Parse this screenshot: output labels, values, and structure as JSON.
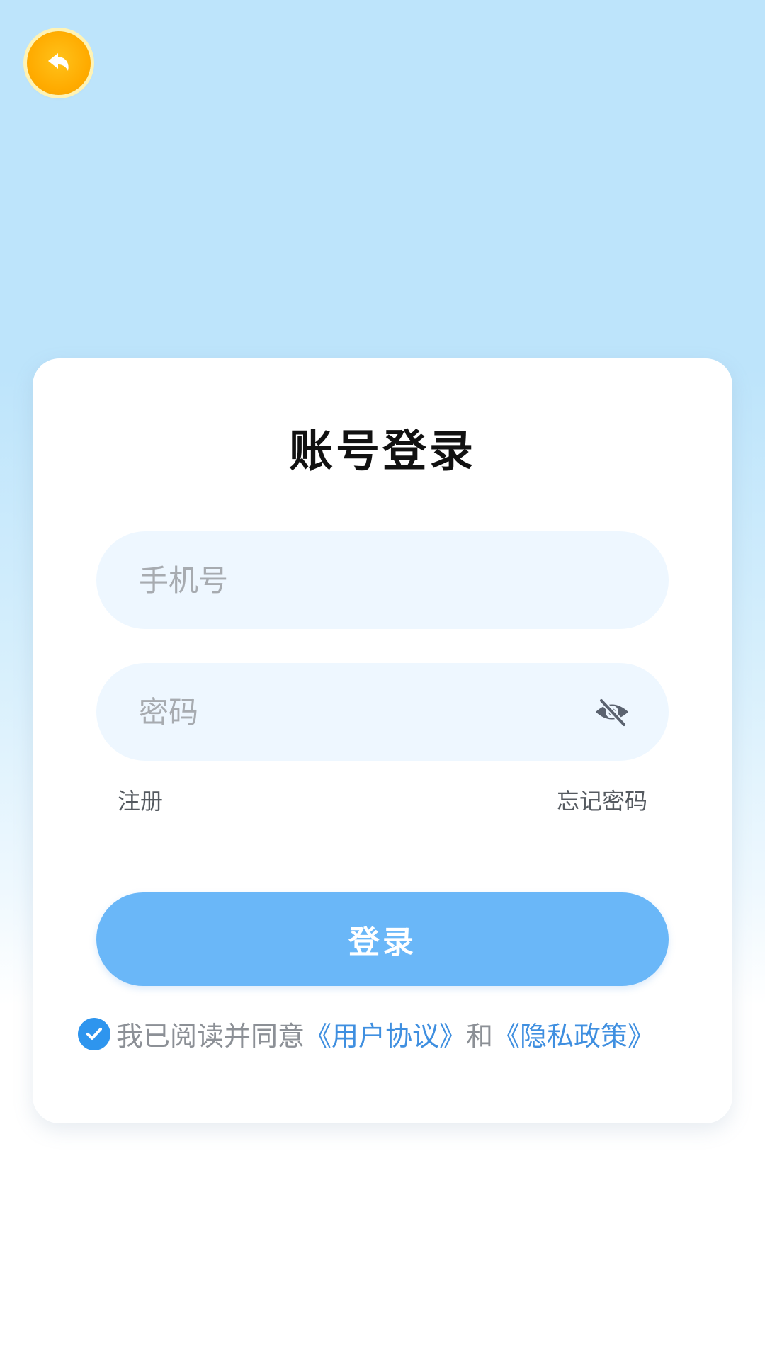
{
  "header": {
    "back_icon": "undo-arrow-icon",
    "back_color": "#ffab00"
  },
  "login_card": {
    "title": "账号登录",
    "phone": {
      "value": "",
      "placeholder": "手机号"
    },
    "password": {
      "value": "",
      "placeholder": "密码",
      "visibility_icon": "eye-off-icon"
    },
    "register_label": "注册",
    "forgot_password_label": "忘记密码",
    "login_button_label": "登录",
    "agreement": {
      "checked": true,
      "prefix": "我已阅读并同意",
      "user_agreement": "《用户协议》",
      "conjunction": "和",
      "privacy_policy": "《隐私政策》"
    }
  },
  "colors": {
    "background_top": "#bde4fb",
    "card": "#ffffff",
    "input_bg": "#eef7ff",
    "login_button": "#6ab7f8",
    "link": "#3f8fe0",
    "checkbox": "#2e95ee"
  }
}
